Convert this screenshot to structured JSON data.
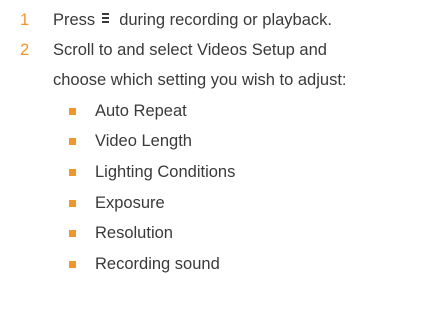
{
  "steps": [
    {
      "number": "1",
      "text_before_icon": "Press",
      "icon": "menu-icon",
      "text_after_icon": "during recording or playback."
    },
    {
      "number": "2",
      "line1": "Scroll to and select Videos Setup and",
      "line2": "choose which setting you wish to adjust:"
    }
  ],
  "settings": [
    "Auto Repeat",
    "Video Length",
    "Lighting Conditions",
    "Exposure",
    "Resolution",
    "Recording sound"
  ],
  "colors": {
    "accent": "#f0962a",
    "text": "#3a3a3a"
  }
}
